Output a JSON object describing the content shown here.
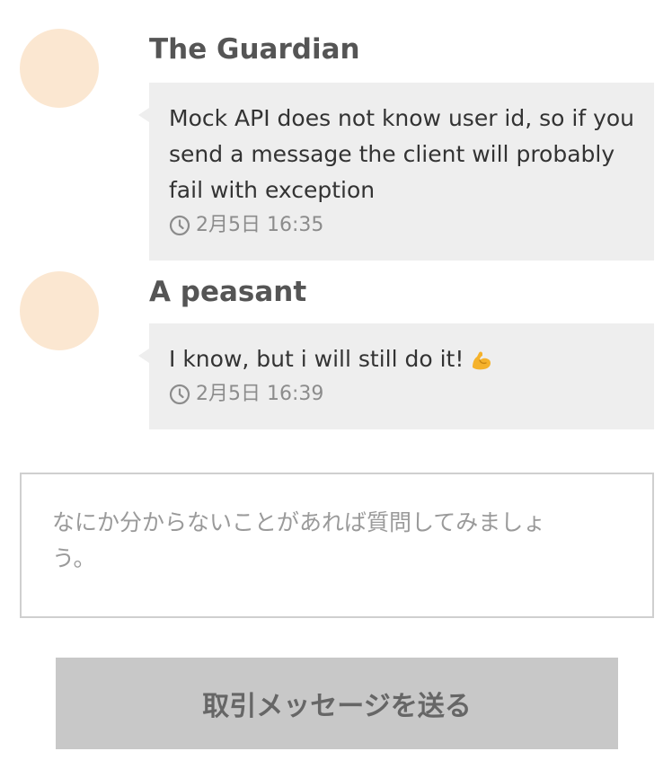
{
  "messages": [
    {
      "sender": "The Guardian",
      "text": "Mock API does not know user id, so if you send a message the client will probably fail with exception",
      "time": "2月5日 16:35",
      "avatar_color": "#fbe7d1"
    },
    {
      "sender": "A peasant",
      "text": "I know, but i will still do it!",
      "emoji": "flexed-biceps",
      "time": "2月5日 16:39",
      "avatar_color": "#fbe7d1"
    }
  ],
  "compose": {
    "placeholder": "なにか分からないことがあれば質問してみましょう。",
    "value": ""
  },
  "send_button": {
    "label": "取引メッセージを送る"
  },
  "colors": {
    "bubble_bg": "#eeeeee",
    "button_bg": "#c8c8c8",
    "avatar": "#fbe7d1",
    "emoji": "#f5b22b"
  },
  "icons": {
    "timestamp": "clock-icon",
    "emoji": "flexed-biceps-icon"
  }
}
